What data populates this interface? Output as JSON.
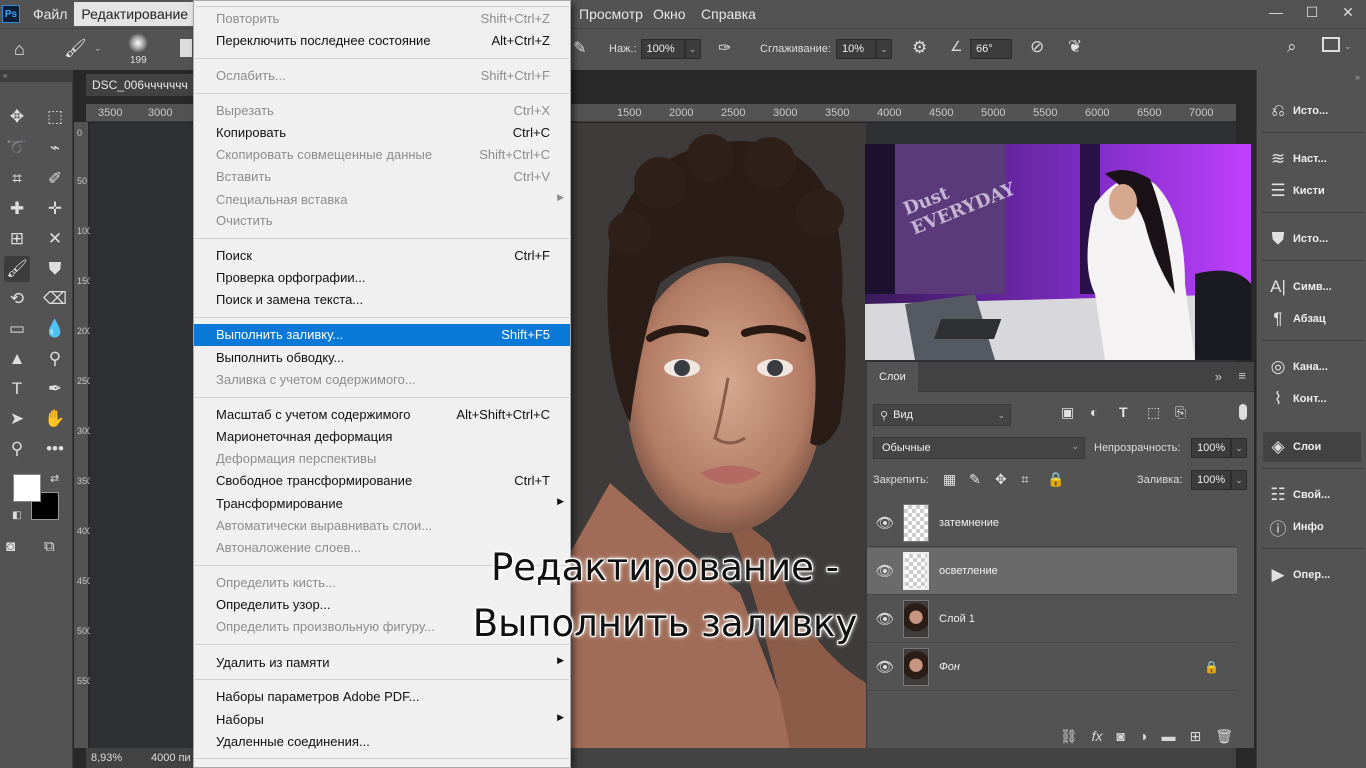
{
  "app": {
    "logo": "Ps"
  },
  "menubar": {
    "items": [
      "Файл",
      "Редактирование",
      "Просмотр",
      "Окно",
      "Справка"
    ]
  },
  "window_controls": {
    "minimize": "—",
    "maximize": "☐",
    "close": "✕"
  },
  "options_bar": {
    "brush_size": "199",
    "pressure_label": "Наж.:",
    "pressure_value": "100%",
    "smoothing_label": "Сглаживание:",
    "smoothing_value": "10%",
    "angle_value": "66°"
  },
  "document": {
    "tab_title": "DSC_006ччччччч",
    "zoom": "8,93%",
    "doc_info": "4000 пи",
    "ruler_ticks": [
      "3500",
      "3000",
      "1500",
      "2000",
      "2500",
      "3000",
      "3500",
      "4000",
      "4500",
      "5000",
      "5500",
      "6000",
      "6500",
      "7000"
    ],
    "vertical_ruler_ticks": [
      "0",
      "50",
      "100",
      "150",
      "200",
      "250",
      "300",
      "350",
      "400",
      "450",
      "500",
      "550"
    ]
  },
  "edit_menu": {
    "items": [
      {
        "label": "Повторить",
        "shortcut": "Shift+Ctrl+Z",
        "disabled": true
      },
      {
        "label": "Переключить последнее состояние",
        "shortcut": "Alt+Ctrl+Z",
        "disabled": false
      },
      {
        "label": "Ослабить...",
        "shortcut": "Shift+Ctrl+F",
        "disabled": true
      },
      {
        "label": "Вырезать",
        "shortcut": "Ctrl+X",
        "disabled": true
      },
      {
        "label": "Копировать",
        "shortcut": "Ctrl+C",
        "disabled": false
      },
      {
        "label": "Скопировать совмещенные данные",
        "shortcut": "Shift+Ctrl+C",
        "disabled": true
      },
      {
        "label": "Вставить",
        "shortcut": "Ctrl+V",
        "disabled": true
      },
      {
        "label": "Специальная вставка",
        "shortcut": "",
        "disabled": true
      },
      {
        "label": "Очистить",
        "shortcut": "",
        "disabled": true
      },
      {
        "label": "Поиск",
        "shortcut": "Ctrl+F",
        "disabled": false
      },
      {
        "label": "Проверка орфографии...",
        "shortcut": "",
        "disabled": false
      },
      {
        "label": "Поиск и замена текста...",
        "shortcut": "",
        "disabled": false
      },
      {
        "label": "Выполнить заливку...",
        "shortcut": "Shift+F5",
        "disabled": false
      },
      {
        "label": "Выполнить обводку...",
        "shortcut": "",
        "disabled": false
      },
      {
        "label": "Заливка с учетом содержимого...",
        "shortcut": "",
        "disabled": true
      },
      {
        "label": "Масштаб с учетом содержимого",
        "shortcut": "Alt+Shift+Ctrl+C",
        "disabled": false
      },
      {
        "label": "Марионеточная деформация",
        "shortcut": "",
        "disabled": false
      },
      {
        "label": "Деформация перспективы",
        "shortcut": "",
        "disabled": true
      },
      {
        "label": "Свободное трансформирование",
        "shortcut": "Ctrl+T",
        "disabled": false
      },
      {
        "label": "Трансформирование",
        "shortcut": "",
        "disabled": false
      },
      {
        "label": "Автоматически выравнивать слои...",
        "shortcut": "",
        "disabled": true
      },
      {
        "label": "Автоналожение слоев...",
        "shortcut": "",
        "disabled": true
      },
      {
        "label": "Определить кисть...",
        "shortcut": "",
        "disabled": true
      },
      {
        "label": "Определить узор...",
        "shortcut": "",
        "disabled": false
      },
      {
        "label": "Определить произвольную фигуру...",
        "shortcut": "",
        "disabled": true
      },
      {
        "label": "Удалить из памяти",
        "shortcut": "",
        "disabled": false
      },
      {
        "label": "Наборы параметров Adobe PDF...",
        "shortcut": "",
        "disabled": false
      },
      {
        "label": "Наборы",
        "shortcut": "",
        "disabled": false
      },
      {
        "label": "Удаленные соединения...",
        "shortcut": "",
        "disabled": false
      }
    ]
  },
  "layers_panel": {
    "tab": "Слои",
    "filter_kind": "Вид",
    "blend_mode": "Обычные",
    "opacity_label": "Непрозрачность:",
    "opacity_value": "100%",
    "lock_label": "Закрепить:",
    "fill_label": "Заливка:",
    "fill_value": "100%",
    "layers": [
      {
        "name": "затемнение"
      },
      {
        "name": "осветление"
      },
      {
        "name": "Слой 1"
      },
      {
        "name": "Фон"
      }
    ]
  },
  "right_dock": {
    "items": [
      "Исто...",
      "Наст...",
      "Кисти",
      "Исто...",
      "Симв...",
      "Абзац",
      "Кана...",
      "Конт...",
      "Слои",
      "Свой...",
      "Инфо",
      "Опер..."
    ]
  },
  "inset_video": {
    "wall_text": "Dust EVERYDAY"
  },
  "caption": {
    "line1": "Редактирование -",
    "line2": "Выполнить заливку"
  },
  "colors": {
    "accent": "#0a78d7",
    "panel": "#535353",
    "menu_bg": "#f0f0f0",
    "neon": "#a020f0"
  }
}
